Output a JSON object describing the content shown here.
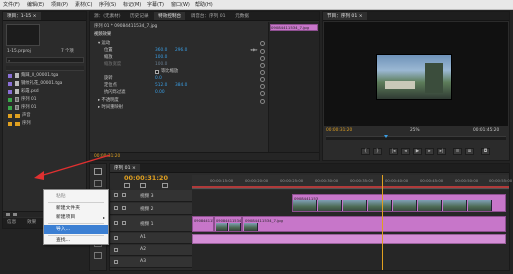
{
  "menubar": {
    "items": [
      "文件(F)",
      "编辑(E)",
      "项目(P)",
      "素材(C)",
      "序列(S)",
      "标记(M)",
      "字幕(T)",
      "窗口(W)",
      "帮助(H)"
    ]
  },
  "project_panel": {
    "tab": "项目：1-15 ×",
    "project_name": "1-15.prproj",
    "item_count": "7 个项",
    "items": [
      {
        "name": "蒴踩_ll_00001.tga",
        "color": "#8a6fd6",
        "icon": "image-icon"
      },
      {
        "name": "钢纹礼花_00001.tga",
        "color": "#8a6fd6",
        "icon": "image-icon"
      },
      {
        "name": "彩霞.psd",
        "color": "#8a6fd6",
        "icon": "image-icon"
      },
      {
        "name": "序列 01",
        "color": "#3aa84a",
        "icon": "sequence-icon"
      },
      {
        "name": "序列 01",
        "color": "#3aa84a",
        "icon": "sequence-icon"
      },
      {
        "name": "声音",
        "color": "#e0a020",
        "icon": "folder-icon"
      },
      {
        "name": "序列",
        "color": "#e0a020",
        "icon": "folder-icon"
      }
    ],
    "bottom_tabs": [
      "信息",
      "效果"
    ]
  },
  "effects_panel": {
    "tabs": [
      "源：(无素材)",
      "历史记录",
      "特效控制台",
      "调音台：序列 01",
      "元数据"
    ],
    "active_tab": "特效控制台",
    "source_label": "序列 01 * 09084411534_7.jpg",
    "clip_chip": "09084411534_7.jpg",
    "section_video": "视频效果",
    "rows": [
      {
        "label": "▾ 运动",
        "values": [],
        "indent": 0
      },
      {
        "label": "位置",
        "values": [
          "360.0",
          "296.0"
        ],
        "indent": 1
      },
      {
        "label": "缩放",
        "values": [
          "100.0"
        ],
        "indent": 1
      },
      {
        "label": "缩放宽度",
        "values": [
          "100.0"
        ],
        "indent": 1,
        "dim": true
      },
      {
        "label": "",
        "values": [],
        "indent": 1,
        "checkbox": "等比缩放"
      },
      {
        "label": "旋转",
        "values": [
          "0.0"
        ],
        "indent": 1
      },
      {
        "label": "定位点",
        "values": [
          "512.0",
          "384.0"
        ],
        "indent": 1
      },
      {
        "label": "抗闪烁过滤",
        "values": [
          "0.00"
        ],
        "indent": 1
      },
      {
        "label": "▸ 不透明度",
        "values": [],
        "indent": 0
      },
      {
        "label": "▸ 时间重映射",
        "values": [],
        "indent": 0
      }
    ],
    "timecode": "00:00:31:20"
  },
  "program_monitor": {
    "tab": "节目：序列 01 ×",
    "timecode": "00:00:31:20",
    "zoom": "25%",
    "duration": "00:01:45:20"
  },
  "timeline": {
    "tab": "序列 01 ×",
    "timecode": "00:00:31:20",
    "ruler_ticks": [
      "00:00:15:00",
      "00:00:20:00",
      "00:00:25:00",
      "00:00:30:00",
      "00:00:35:00",
      "00:00:40:00",
      "00:00:45:00",
      "00:00:50:00",
      "00:00:55:00"
    ],
    "tracks": [
      {
        "name": "视频 3",
        "type": "video"
      },
      {
        "name": "视频 2",
        "type": "video"
      },
      {
        "name": "视频 1",
        "type": "video"
      },
      {
        "name": "A1",
        "type": "audio"
      },
      {
        "name": "A2",
        "type": "audio"
      },
      {
        "name": "A3",
        "type": "audio"
      }
    ],
    "clip_labels": [
      "09084411534_7.jpg",
      "0908441153",
      "09084411534",
      "0908441153"
    ]
  },
  "context_menu": {
    "items": [
      {
        "label": "粘贴",
        "disabled": true
      },
      {
        "label": "新建文件夹",
        "disabled": false
      },
      {
        "label": "新建项目",
        "disabled": false,
        "submenu": true
      },
      {
        "label": "导入...",
        "disabled": false,
        "highlighted": true
      },
      {
        "label": "查找...",
        "disabled": false
      }
    ]
  },
  "colors": {
    "accent": "#3a9fe6",
    "clip": "#c776c9",
    "arrow": "#e03030",
    "playhead": "#e0a020"
  }
}
